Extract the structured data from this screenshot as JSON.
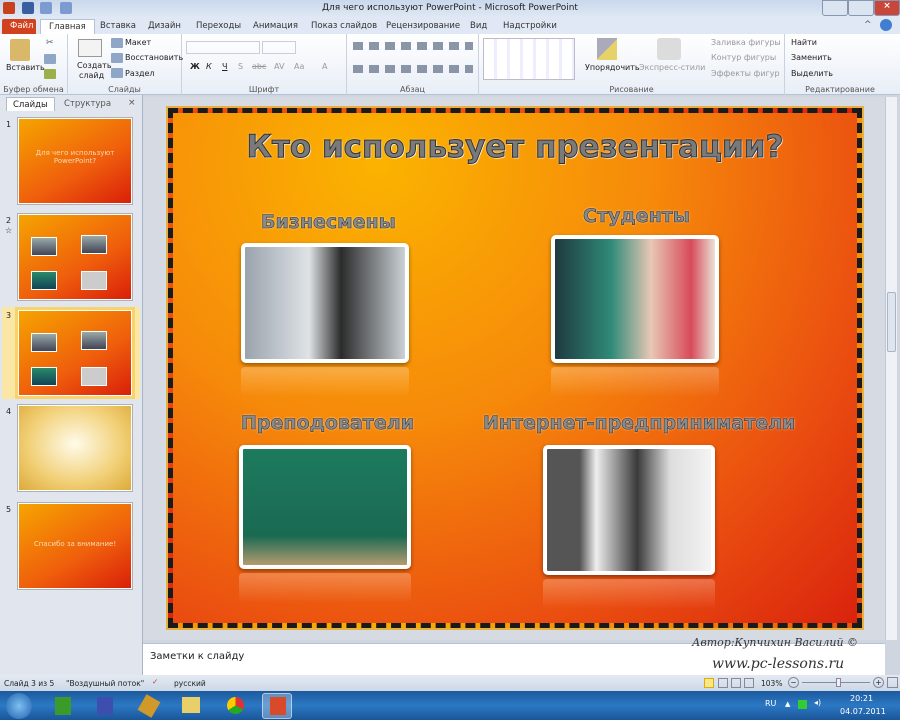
{
  "window": {
    "title": "Для чего используют PowerPoint - Microsoft PowerPoint"
  },
  "tabs": [
    "Файл",
    "Главная",
    "Вставка",
    "Дизайн",
    "Переходы",
    "Анимация",
    "Показ слайдов",
    "Рецензирование",
    "Вид",
    "Надстройки"
  ],
  "ribbon": {
    "clipboard": {
      "paste": "Вставить",
      "label": "Буфер обмена"
    },
    "slides": {
      "new_slide_1": "Создать",
      "new_slide_2": "слайд",
      "layout": "Макет",
      "reset": "Восстановить",
      "section": "Раздел",
      "label": "Слайды"
    },
    "font": {
      "label": "Шрифт",
      "bold": "Ж",
      "italic": "К",
      "underline": "Ч",
      "shadow": "S",
      "strike": "abc",
      "spacing": "AV",
      "case": "Aa",
      "color": "A"
    },
    "paragraph": {
      "label": "Абзац"
    },
    "drawing": {
      "arrange": "Упорядочить",
      "quick_styles": "Экспресс-стили",
      "fill": "Заливка фигуры",
      "outline": "Контур фигуры",
      "effects": "Эффекты фигур",
      "label": "Рисование"
    },
    "editing": {
      "find": "Найти",
      "replace": "Заменить",
      "select": "Выделить",
      "label": "Редактирование"
    }
  },
  "panel": {
    "tabs": [
      "Слайды",
      "Структура"
    ],
    "thumbs": [
      {
        "num": "1",
        "text": "Для чего используют PowerPoint?"
      },
      {
        "num": "2",
        "text": ""
      },
      {
        "num": "3",
        "text": ""
      },
      {
        "num": "4",
        "text": ""
      },
      {
        "num": "5",
        "text": "Спасибо за внимание!"
      }
    ]
  },
  "slide": {
    "title": "Кто использует презентации?",
    "items": [
      "Бизнесмены",
      "Студенты",
      "Преподователи",
      "Интернет-предприниматели"
    ]
  },
  "notes": {
    "placeholder": "Заметки к слайду"
  },
  "watermark": {
    "author": "Автор:Купчихин Василий ©",
    "site": "www.pc-lessons.ru"
  },
  "status": {
    "slide": "Слайд 3 из 5",
    "theme": "\"Воздушный поток\"",
    "lang": "русский",
    "zoom": "103%",
    "zoom_fraction": 0.55
  },
  "taskbar": {
    "lang": "RU",
    "time": "20:21",
    "date": "04.07.2011"
  }
}
